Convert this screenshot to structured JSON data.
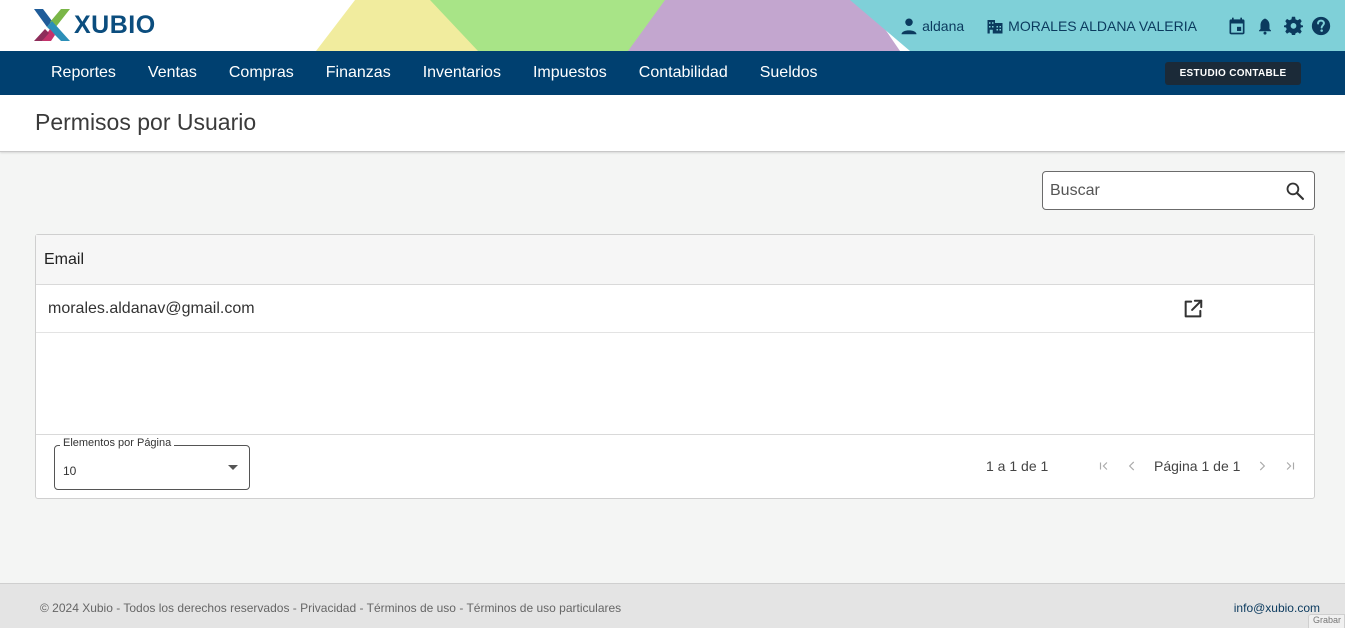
{
  "header": {
    "logo_text": "XUBIO",
    "user_name": "aldana",
    "company_name": "MORALES ALDANA VALERIA",
    "icons": [
      "user-icon",
      "company-icon",
      "calendar-icon",
      "bell-icon",
      "gear-icon",
      "help-icon"
    ]
  },
  "nav": {
    "items": [
      "Reportes",
      "Ventas",
      "Compras",
      "Finanzas",
      "Inventarios",
      "Impuestos",
      "Contabilidad",
      "Sueldos"
    ],
    "studio_button": "ESTUDIO CONTABLE"
  },
  "page": {
    "title": "Permisos por Usuario"
  },
  "search": {
    "placeholder": "Buscar"
  },
  "table": {
    "columns": [
      "Email"
    ],
    "rows": [
      {
        "email": "morales.aldanav@gmail.com"
      }
    ],
    "per_page_label": "Elementos por Página",
    "per_page_value": "10",
    "range_text": "1 a 1 de 1",
    "page_label": "Página 1 de 1"
  },
  "footer": {
    "copyright": "© 2024 Xubio",
    "links": [
      "Todos los derechos reservados",
      "Privacidad",
      "Términos de uso",
      "Términos de uso particulares"
    ],
    "email": "info@xubio.com",
    "corner_tab": "Grabar"
  },
  "colors": {
    "nav_bg": "#004070",
    "brand": "#0b4d7e",
    "header_accent": "#7fd0d8"
  }
}
